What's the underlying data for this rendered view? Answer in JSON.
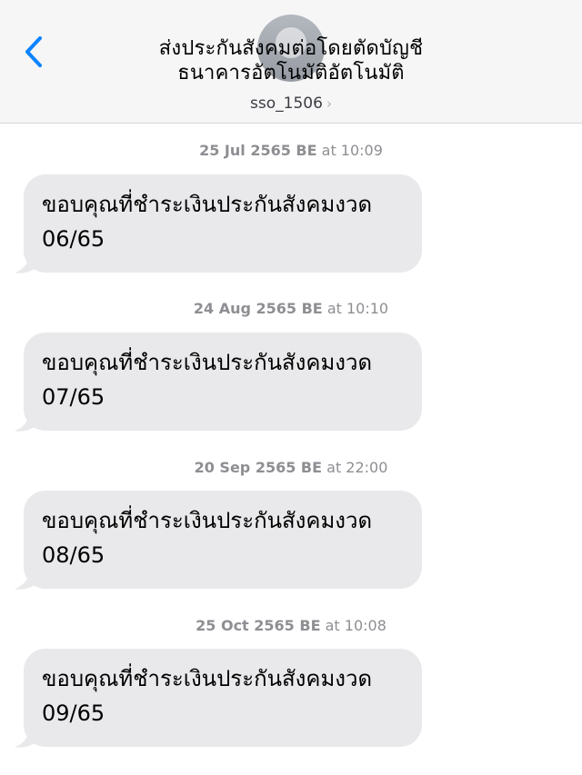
{
  "header": {
    "title_line1": "ส่งประกันสังคมต่อโดยตัดบัญชี",
    "title_line2": "ธนาคารอัตโนมัติอัตโนมัติ",
    "contact": "sso_1506",
    "contact_chevron": "›"
  },
  "colors": {
    "accent": "#0a84ff",
    "bubble": "#e9e9eb",
    "timestamp": "#8e8e93",
    "header_bg": "#f6f6f7"
  },
  "messages": [
    {
      "date": "25 Jul 2565 BE",
      "time": "at 10:09",
      "line1": "ขอบคุณที่ชำระเงินประกันสังคมงวด",
      "line2": "06/65"
    },
    {
      "date": "24 Aug 2565 BE",
      "time": "at 10:10",
      "line1": "ขอบคุณที่ชำระเงินประกันสังคมงวด",
      "line2": "07/65"
    },
    {
      "date": "20 Sep 2565 BE",
      "time": "at 22:00",
      "line1": "ขอบคุณที่ชำระเงินประกันสังคมงวด",
      "line2": "08/65"
    },
    {
      "date": "25 Oct 2565 BE",
      "time": "at 10:08",
      "line1": "ขอบคุณที่ชำระเงินประกันสังคมงวด",
      "line2": "09/65"
    }
  ]
}
